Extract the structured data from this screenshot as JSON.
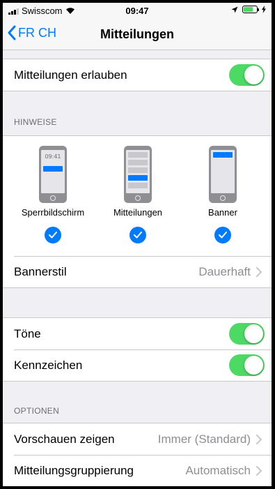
{
  "status_bar": {
    "carrier": "Swisscom",
    "time": "09:47"
  },
  "nav": {
    "back_label": "FR CH",
    "title": "Mitteilungen"
  },
  "allow": {
    "label": "Mitteilungen erlauben",
    "enabled": true
  },
  "alerts": {
    "header": "HINWEISE",
    "styles": [
      {
        "label": "Sperrbildschirm",
        "preview_time": "09:41",
        "checked": true
      },
      {
        "label": "Mitteilungen",
        "checked": true
      },
      {
        "label": "Banner",
        "checked": true
      }
    ],
    "banner_style": {
      "label": "Bannerstil",
      "value": "Dauerhaft"
    }
  },
  "sounds": {
    "label": "Töne",
    "enabled": true
  },
  "badges": {
    "label": "Kennzeichen",
    "enabled": true
  },
  "options": {
    "header": "OPTIONEN",
    "show_previews": {
      "label": "Vorschauen zeigen",
      "value": "Immer (Standard)"
    },
    "grouping": {
      "label": "Mitteilungsgruppierung",
      "value": "Automatisch"
    }
  },
  "colors": {
    "accent": "#007aff",
    "toggle_on": "#4cd964",
    "background": "#efeff4",
    "secondary_text": "#8e8e93"
  }
}
